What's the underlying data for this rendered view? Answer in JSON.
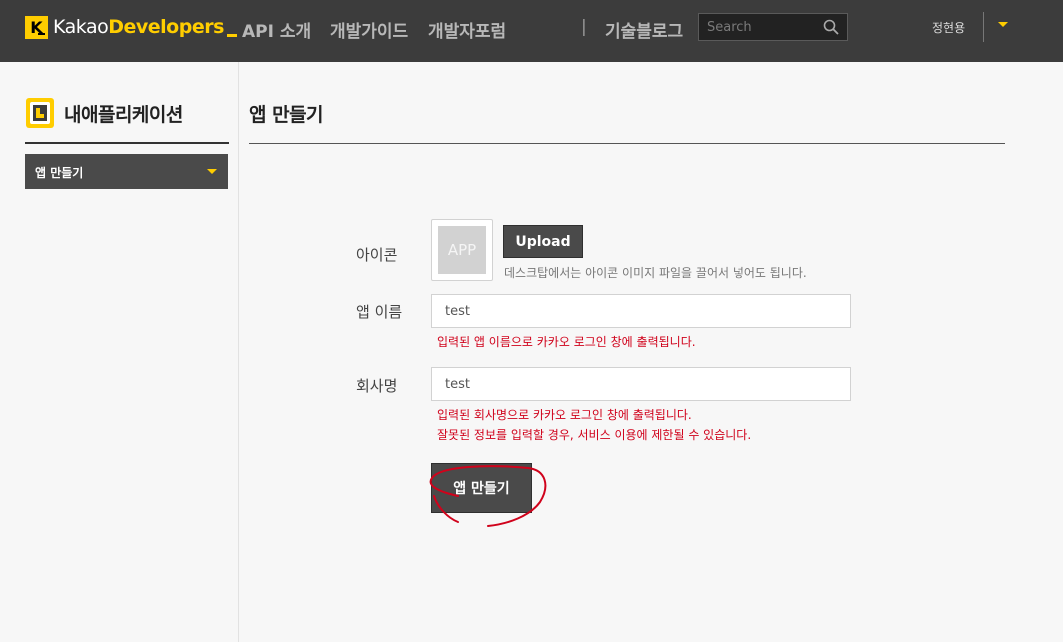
{
  "header": {
    "logo_mark": "K",
    "logo_word_a": "Kakao",
    "logo_word_b": "Developers",
    "nav": [
      "API 소개",
      "개발가이드",
      "개발자포럼",
      "|",
      "기술블로그"
    ],
    "search_placeholder": "Search",
    "user_name": "정현용",
    "accent_color": "#ffcd00"
  },
  "sidebar": {
    "title": "내애플리케이션",
    "menu_selected": "앱 만들기"
  },
  "main": {
    "title": "앱 만들기",
    "icon_label": "아이콘",
    "icon_placeholder": "APP",
    "upload_label": "Upload",
    "icon_help": "데스크탑에서는 아이콘 이미지 파일을 끌어서 넣어도 됩니다.",
    "name_label": "앱 이름",
    "name_value": "test",
    "name_error": "입력된 앱 이름으로 카카오 로그인 창에 출력됩니다.",
    "company_label": "회사명",
    "company_value": "test",
    "company_error_1": "입력된 회사명으로 카카오 로그인 창에 출력됩니다.",
    "company_error_2": "잘못된 정보를 입력할 경우, 서비스 이용에 제한될 수 있습니다.",
    "create_label": "앱 만들기",
    "error_color": "#d0021b"
  }
}
